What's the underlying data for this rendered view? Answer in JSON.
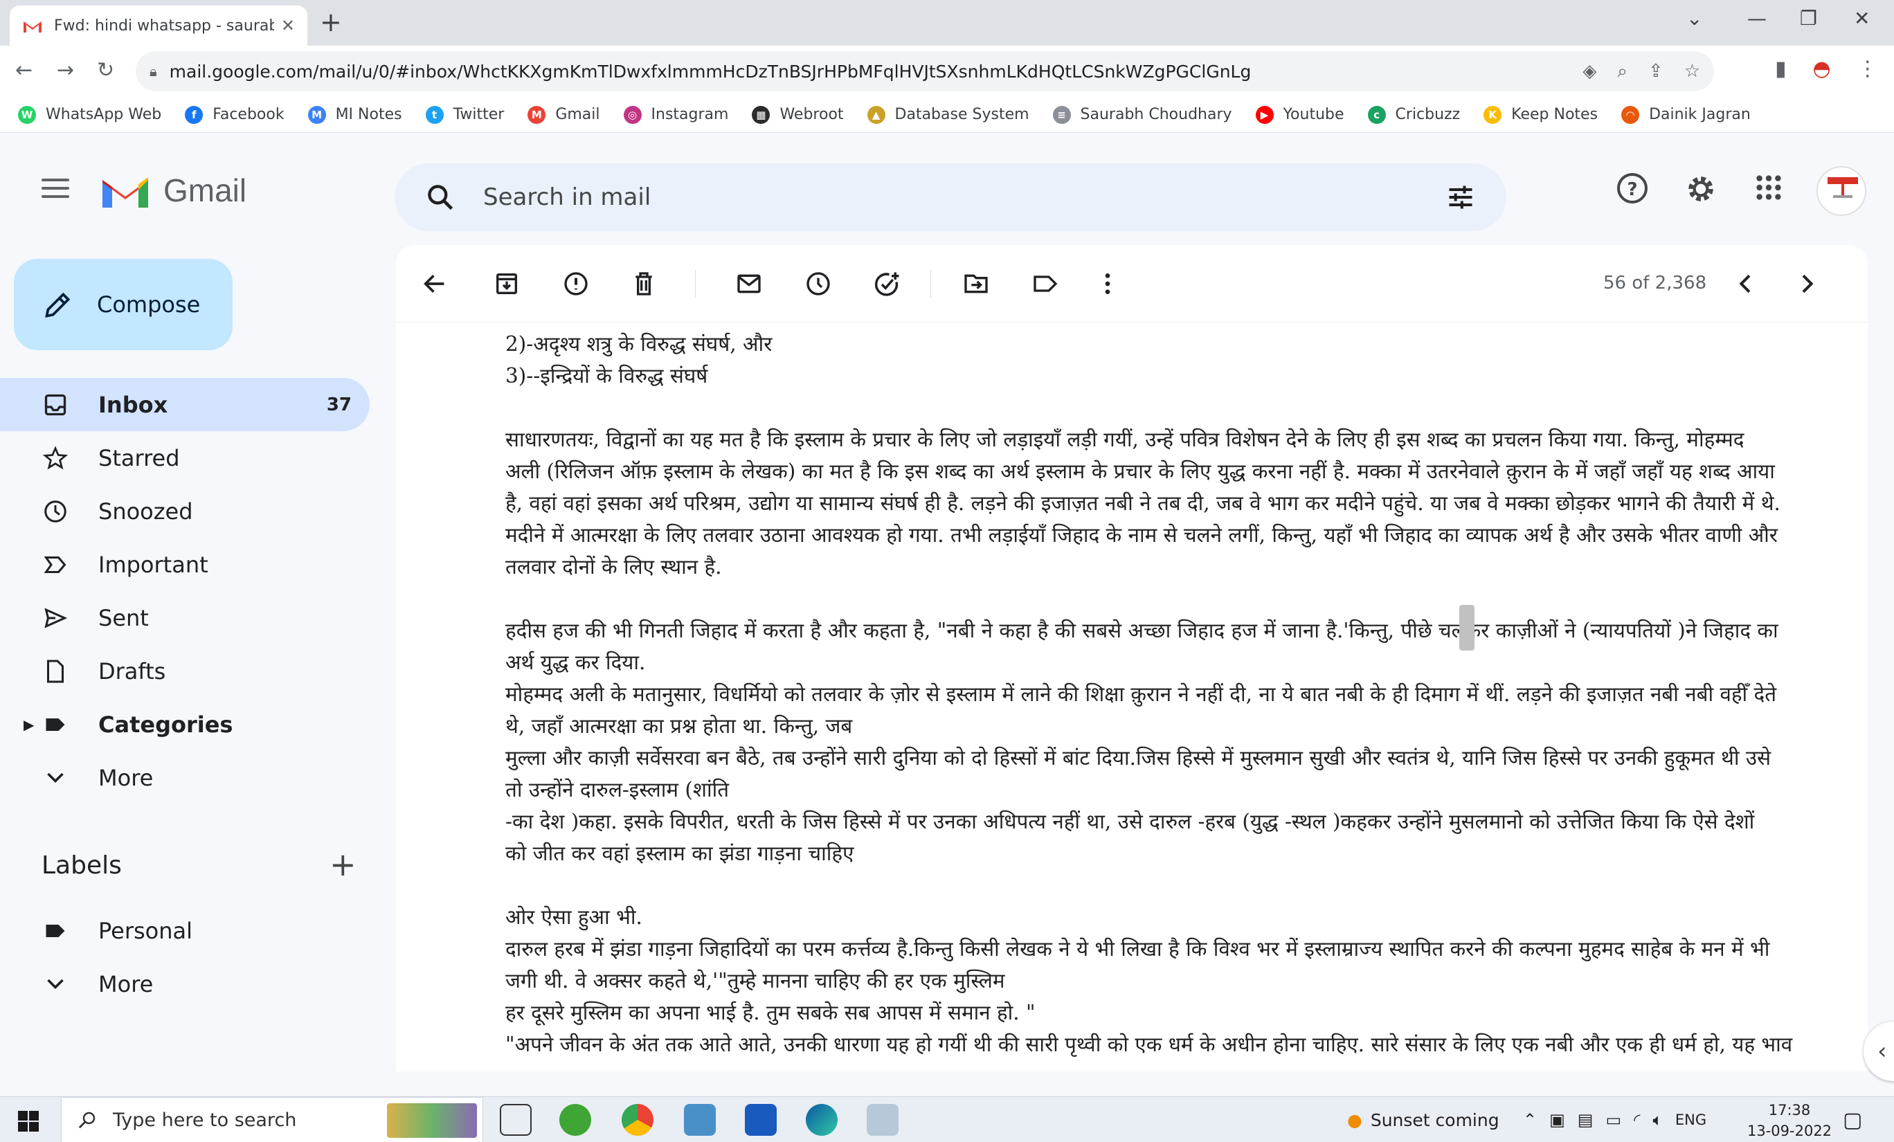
{
  "browser": {
    "tab_title": "Fwd: hindi whatsapp - saurabhch",
    "url": "mail.google.com/mail/u/0/#inbox/WhctKKXgmKmTlDwxfxlmmmHcDzTnBSJrHPbMFqlHVJtSXsnhmLKdHQtLCSnkWZgPGClGnLg",
    "bookmarks": [
      {
        "label": "WhatsApp Web",
        "color": "#25d366",
        "glyph": "W"
      },
      {
        "label": "Facebook",
        "color": "#1877f2",
        "glyph": "f"
      },
      {
        "label": "MI Notes",
        "color": "#3b82f6",
        "glyph": "M"
      },
      {
        "label": "Twitter",
        "color": "#1da1f2",
        "glyph": "t"
      },
      {
        "label": "Gmail",
        "color": "#ea4335",
        "glyph": "M"
      },
      {
        "label": "Instagram",
        "color": "#c13584",
        "glyph": "◎"
      },
      {
        "label": "Webroot",
        "color": "#2b2b2b",
        "glyph": "▦"
      },
      {
        "label": "Database System",
        "color": "#c9a227",
        "glyph": "▲"
      },
      {
        "label": "Saurabh Choudhary",
        "color": "#8a8f98",
        "glyph": "≡"
      },
      {
        "label": "Youtube",
        "color": "#ff0000",
        "glyph": "▶"
      },
      {
        "label": "Cricbuzz",
        "color": "#1aa260",
        "glyph": "c"
      },
      {
        "label": "Keep Notes",
        "color": "#fbbc04",
        "glyph": "K"
      },
      {
        "label": "Dainik Jagran",
        "color": "#e8590c",
        "glyph": "◠"
      }
    ]
  },
  "gmail": {
    "logo_text": "Gmail",
    "search_placeholder": "Search in mail",
    "compose_label": "Compose",
    "nav": [
      {
        "label": "Inbox",
        "count": "37",
        "icon": "inbox-icon"
      },
      {
        "label": "Starred",
        "count": "",
        "icon": "star-icon"
      },
      {
        "label": "Snoozed",
        "count": "",
        "icon": "clock-icon"
      },
      {
        "label": "Important",
        "count": "",
        "icon": "important-icon"
      },
      {
        "label": "Sent",
        "count": "",
        "icon": "send-icon"
      },
      {
        "label": "Drafts",
        "count": "",
        "icon": "draft-icon"
      },
      {
        "label": "Categories",
        "count": "",
        "icon": "label-icon"
      },
      {
        "label": "More",
        "count": "",
        "icon": "chevron-down-icon"
      }
    ],
    "labels_heading": "Labels",
    "labels": [
      {
        "label": "Personal",
        "icon": "label-icon"
      },
      {
        "label": "More",
        "icon": "chevron-down-icon"
      }
    ],
    "pager": "56 of 2,368",
    "email_lines": [
      "2)-अदृश्य शत्रु के विरुद्ध संघर्ष, और",
      "3)--इन्द्रियों के विरुद्ध संघर्ष",
      "",
      "साधारणतयः, विद्वानों का यह मत है कि इस्लाम के प्रचार के लिए जो लड़ाइयाँ लड़ी गयीं, उन्हें पवित्र विशेषन देने के लिए ही इस शब्द का प्रचलन किया गया. किन्तु, मोहम्मद",
      "अली (रिलिजन ऑफ़ इस्लाम के लेखक) का मत है कि इस शब्द का अर्थ इस्लाम के प्रचार के लिए युद्ध करना नहीं है. मक्का में उतरनेवाले क़ुरान के में जहाँ जहाँ यह शब्द आया",
      "है, वहां वहां इसका अर्थ परिश्रम, उद्योग या सामान्य संघर्ष ही है. लड़ने की इजाज़त नबी ने तब दी, जब वे भाग कर मदीने पहुंचे. या जब वे मक्का छोड़कर भागने की तैयारी में थे.",
      "मदीने में आत्मरक्षा के लिए तलवार उठाना आवश्यक हो गया. तभी लड़ाईयाँ जिहाद के नाम से चलने लगीं, किन्तु, यहाँ भी जिहाद का व्यापक अर्थ है और उसके भीतर वाणी और",
      "तलवार दोनों के लिए स्थान है.",
      "",
      "हदीस  हज की भी गिनती जिहाद में करता है और कहता है, \"नबी ने कहा है की सबसे अच्छा जिहाद हज में जाना है.'किन्तु, पीछे चलकर काज़ीओं ने (न्यायपतियों )ने जिहाद का",
      "अर्थ युद्ध कर दिया.",
      "मोहम्मद अली के मतानुसार, विधर्मियो को तलवार के ज़ोर से इस्लाम में लाने की शिक्षा क़ुरान ने नहीं दी, ना ये बात नबी के ही दिमाग में थीं. लड़ने की इजाज़त नबी नबी वहीँ देते",
      "थे, जहाँ आत्मरक्षा का प्रश्न होता था. किन्तु, जब",
      "मुल्ला और काज़ी सर्वेसरवा बन बैठे, तब उन्होंने सारी दुनिया को दो हिस्सों में बांट दिया.जिस हिस्से में मुस्लमान सुखी और स्वतंत्र थे, यानि जिस हिस्से पर उनकी हुकूमत थी उसे",
      "तो उन्होंने दारुल-इस्लाम (शांति",
      "-का देश )कहा. इसके विपरीत, धरती के जिस हिस्से में पर उनका अधिपत्य नहीं था, उसे दारुल -हरब (युद्ध -स्थल )कहकर उन्होंने मुसलमानो को उत्तेजित किया कि ऐसे देशों",
      "को जीत कर वहां इस्लाम का झंडा गाड़ना चाहिए",
      "",
      "ओर ऐसा हुआ भी.",
      "दारुल हरब में झंडा गाड़ना जिहादियों का परम कर्त्तव्य है.किन्तु किसी लेखक ने ये भी लिखा है कि विश्व भर में इस्लाम्राज्य स्थापित करने की कल्पना मुहमद साहेब के मन में भी",
      "जगी थी. वे अक्सर कहते थे,'\"तुम्हे मानना चाहिए की हर एक मुस्लिम",
      "हर दूसरे मुस्लिम का अपना भाई है. तुम सबके सब आपस में समान हो. \"",
      "\"अपने जीवन के अंत तक आते आते, उनकी धारणा यह हो गयीं थी की सारी पृथ्वी को एक धर्म के अधीन होना चाहिए. सारे संसार के लिए एक नबी और एक ही धर्म हो, यह भाव"
    ]
  },
  "taskbar": {
    "search_placeholder": "Type here to search",
    "weather": "Sunset coming",
    "language": "ENG",
    "time": "17:38",
    "date": "13-09-2022"
  },
  "colors": {
    "gmail_red": "#ea4335",
    "compose_bg": "#c2e7ff",
    "active_nav": "#d3e3fd"
  }
}
